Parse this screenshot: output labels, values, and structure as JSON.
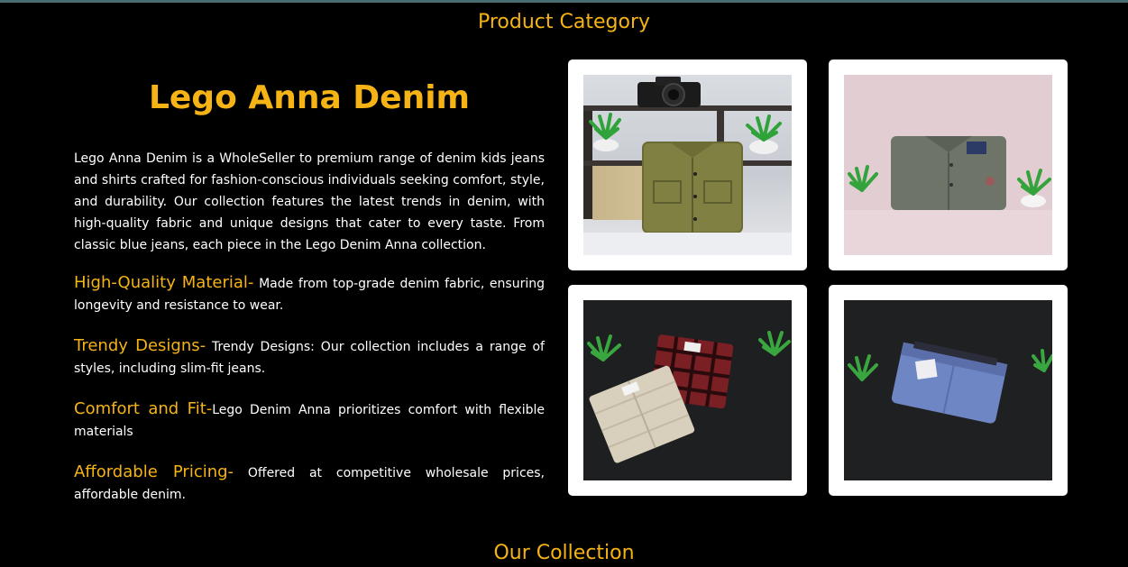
{
  "page": {
    "section_title": "Product Category",
    "bottom_title": "Our Collection"
  },
  "brand": {
    "heading": "Lego Anna Denim",
    "description": "Lego Anna Denim is a WholeSeller to premium range of denim kids jeans and shirts crafted for fashion-conscious individuals seeking comfort, style, and durability. Our collection features the latest trends in denim, with high-quality fabric and unique designs that cater to every taste. From classic blue jeans, each piece in the Lego Denim Anna collection."
  },
  "features": [
    {
      "label": "High-Quality Material-",
      "text": " Made from top-grade denim fabric, ensuring longevity and resistance to wear."
    },
    {
      "label": "Trendy Designs-",
      "text": " Trendy Designs: Our collection includes a range of styles, including slim-fit jeans."
    },
    {
      "label": "Comfort and Fit-",
      "text": "Lego Denim Anna prioritizes comfort with flexible materials"
    },
    {
      "label": "Affordable Pricing-",
      "text": " Offered at competitive wholesale prices, affordable denim."
    }
  ],
  "gallery": [
    {
      "subject": "olive-shirt-with-camera"
    },
    {
      "subject": "grey-shirt-pink-backdrop"
    },
    {
      "subject": "checked-shirts-dark-backdrop"
    },
    {
      "subject": "blue-jeans-dark-backdrop"
    }
  ],
  "colors": {
    "accent": "#f5b316",
    "background": "#000000",
    "text": "#ffffff",
    "card": "#ffffff"
  }
}
